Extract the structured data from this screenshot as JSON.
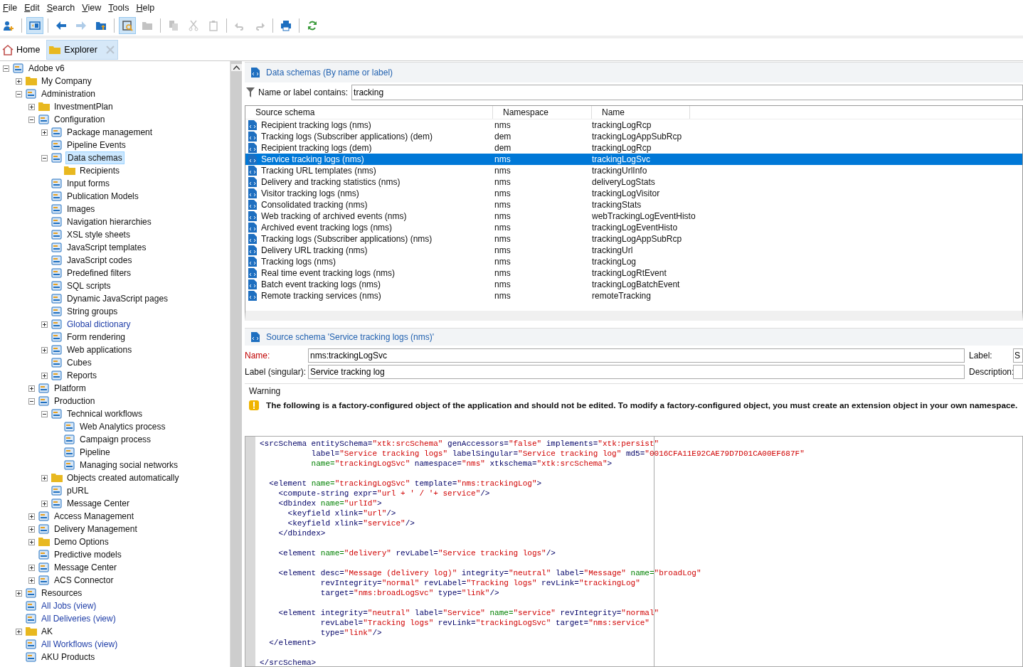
{
  "menu": [
    {
      "label": "File"
    },
    {
      "label": "Edit"
    },
    {
      "label": "Search"
    },
    {
      "label": "View"
    },
    {
      "label": "Tools"
    },
    {
      "label": "Help"
    }
  ],
  "toolbar": [
    {
      "pressed": false,
      "disabled": false
    },
    {
      "pressed": true,
      "disabled": false
    },
    {
      "pressed": false,
      "disabled": false
    },
    {
      "pressed": false,
      "disabled": true
    },
    {
      "pressed": false,
      "disabled": false
    },
    {
      "pressed": true,
      "disabled": false
    },
    {
      "pressed": false,
      "disabled": true
    },
    {
      "pressed": false,
      "disabled": true
    },
    {
      "pressed": false,
      "disabled": true
    },
    {
      "pressed": false,
      "disabled": true
    },
    {
      "pressed": false,
      "disabled": true
    },
    {
      "pressed": false,
      "disabled": true
    },
    {
      "pressed": false,
      "disabled": false
    },
    {
      "pressed": false,
      "disabled": false
    }
  ],
  "tabs": [
    {
      "label": "Home",
      "selected": false
    },
    {
      "label": "Explorer",
      "selected": true
    }
  ],
  "tree": [
    {
      "label": "Adobe v6",
      "kind": "item",
      "view": false,
      "selected": false,
      "expanded": true,
      "children": [
        {
          "label": "My Company",
          "kind": "folder",
          "view": false,
          "selected": false,
          "expanded": false
        },
        {
          "label": "Administration",
          "kind": "item",
          "view": false,
          "selected": false,
          "expanded": true,
          "children": [
            {
              "label": "InvestmentPlan",
              "kind": "folder",
              "view": false,
              "selected": false,
              "expanded": false
            },
            {
              "label": "Configuration",
              "kind": "item",
              "view": false,
              "selected": false,
              "expanded": true,
              "children": [
                {
                  "label": "Package management",
                  "kind": "item",
                  "view": false,
                  "selected": false,
                  "expanded": false
                },
                {
                  "label": "Pipeline Events",
                  "kind": "item",
                  "view": false,
                  "selected": false
                },
                {
                  "label": "Data schemas",
                  "kind": "item",
                  "view": false,
                  "selected": true,
                  "expanded": true,
                  "children": [
                    {
                      "label": "Recipients",
                      "kind": "folder",
                      "view": false,
                      "selected": false
                    }
                  ]
                },
                {
                  "label": "Input forms",
                  "kind": "item",
                  "view": false,
                  "selected": false
                },
                {
                  "label": "Publication Models",
                  "kind": "item",
                  "view": false,
                  "selected": false
                },
                {
                  "label": "Images",
                  "kind": "item",
                  "view": false,
                  "selected": false
                },
                {
                  "label": "Navigation hierarchies",
                  "kind": "item",
                  "view": false,
                  "selected": false
                },
                {
                  "label": "XSL style sheets",
                  "kind": "item",
                  "view": false,
                  "selected": false
                },
                {
                  "label": "JavaScript templates",
                  "kind": "item",
                  "view": false,
                  "selected": false
                },
                {
                  "label": "JavaScript codes",
                  "kind": "item",
                  "view": false,
                  "selected": false
                },
                {
                  "label": "Predefined filters",
                  "kind": "item",
                  "view": false,
                  "selected": false
                },
                {
                  "label": "SQL scripts",
                  "kind": "item",
                  "view": false,
                  "selected": false
                },
                {
                  "label": "Dynamic JavaScript pages",
                  "kind": "item",
                  "view": false,
                  "selected": false
                },
                {
                  "label": "String groups",
                  "kind": "item",
                  "view": false,
                  "selected": false
                },
                {
                  "label": "Global dictionary",
                  "kind": "item",
                  "view": true,
                  "selected": false,
                  "expanded": false
                },
                {
                  "label": "Form rendering",
                  "kind": "item",
                  "view": false,
                  "selected": false
                },
                {
                  "label": "Web applications",
                  "kind": "item",
                  "view": false,
                  "selected": false,
                  "expanded": false
                },
                {
                  "label": "Cubes",
                  "kind": "item",
                  "view": false,
                  "selected": false
                },
                {
                  "label": "Reports",
                  "kind": "item",
                  "view": false,
                  "selected": false,
                  "expanded": false
                }
              ]
            },
            {
              "label": "Platform",
              "kind": "item",
              "view": false,
              "selected": false,
              "expanded": false
            },
            {
              "label": "Production",
              "kind": "item",
              "view": false,
              "selected": false,
              "expanded": true,
              "children": [
                {
                  "label": "Technical workflows",
                  "kind": "item",
                  "view": false,
                  "selected": false,
                  "expanded": true,
                  "children": [
                    {
                      "label": "Web Analytics process",
                      "kind": "item",
                      "view": false,
                      "selected": false
                    },
                    {
                      "label": "Campaign process",
                      "kind": "item",
                      "view": false,
                      "selected": false
                    },
                    {
                      "label": "Pipeline",
                      "kind": "item",
                      "view": false,
                      "selected": false
                    },
                    {
                      "label": "Managing social networks",
                      "kind": "item",
                      "view": false,
                      "selected": false
                    }
                  ]
                },
                {
                  "label": "Objects created automatically",
                  "kind": "folder",
                  "view": false,
                  "selected": false,
                  "expanded": false
                },
                {
                  "label": "pURL",
                  "kind": "item",
                  "view": false,
                  "selected": false
                },
                {
                  "label": "Message Center",
                  "kind": "item",
                  "view": false,
                  "selected": false,
                  "expanded": false
                }
              ]
            },
            {
              "label": "Access Management",
              "kind": "item",
              "view": false,
              "selected": false,
              "expanded": false
            },
            {
              "label": "Delivery Management",
              "kind": "item",
              "view": false,
              "selected": false,
              "expanded": false
            },
            {
              "label": "Demo Options",
              "kind": "folder",
              "view": false,
              "selected": false,
              "expanded": false
            },
            {
              "label": "Predictive models",
              "kind": "item",
              "view": false,
              "selected": false
            },
            {
              "label": "Message Center",
              "kind": "item",
              "view": false,
              "selected": false,
              "expanded": false
            },
            {
              "label": "ACS Connector",
              "kind": "item",
              "view": false,
              "selected": false,
              "expanded": false
            }
          ]
        },
        {
          "label": "Resources",
          "kind": "item",
          "view": false,
          "selected": false,
          "expanded": false
        },
        {
          "label": "All Jobs (view)",
          "kind": "item",
          "view": true,
          "selected": false
        },
        {
          "label": "All Deliveries (view)",
          "kind": "item",
          "view": true,
          "selected": false
        },
        {
          "label": "AK",
          "kind": "folder",
          "view": false,
          "selected": false,
          "expanded": false
        },
        {
          "label": "All Workflows (view)",
          "kind": "item",
          "view": true,
          "selected": false
        },
        {
          "label": "AKU Products",
          "kind": "item",
          "view": false,
          "selected": false
        }
      ]
    }
  ],
  "list_panel": {
    "title": "Data schemas (By name or label)",
    "filter_label": "Name or label contains:",
    "filter_value": "tracking",
    "columns": [
      "Source schema",
      "Namespace",
      "Name"
    ],
    "rows": [
      {
        "source_schema": "Recipient tracking logs (nms)",
        "namespace": "nms",
        "name": "trackingLogRcp",
        "selected": false
      },
      {
        "source_schema": "Tracking logs (Subscriber applications) (dem)",
        "namespace": "dem",
        "name": "trackingLogAppSubRcp",
        "selected": false
      },
      {
        "source_schema": "Recipient tracking logs (dem)",
        "namespace": "dem",
        "name": "trackingLogRcp",
        "selected": false
      },
      {
        "source_schema": "Service tracking logs (nms)",
        "namespace": "nms",
        "name": "trackingLogSvc",
        "selected": true
      },
      {
        "source_schema": "Tracking URL templates (nms)",
        "namespace": "nms",
        "name": "trackingUrlInfo",
        "selected": false
      },
      {
        "source_schema": "Delivery and tracking statistics (nms)",
        "namespace": "nms",
        "name": "deliveryLogStats",
        "selected": false
      },
      {
        "source_schema": "Visitor tracking logs (nms)",
        "namespace": "nms",
        "name": "trackingLogVisitor",
        "selected": false
      },
      {
        "source_schema": "Consolidated tracking (nms)",
        "namespace": "nms",
        "name": "trackingStats",
        "selected": false
      },
      {
        "source_schema": "Web tracking of archived events (nms)",
        "namespace": "nms",
        "name": "webTrackingLogEventHisto",
        "selected": false
      },
      {
        "source_schema": "Archived event tracking logs (nms)",
        "namespace": "nms",
        "name": "trackingLogEventHisto",
        "selected": false
      },
      {
        "source_schema": "Tracking logs (Subscriber applications) (nms)",
        "namespace": "nms",
        "name": "trackingLogAppSubRcp",
        "selected": false
      },
      {
        "source_schema": "Delivery URL tracking (nms)",
        "namespace": "nms",
        "name": "trackingUrl",
        "selected": false
      },
      {
        "source_schema": "Tracking logs (nms)",
        "namespace": "nms",
        "name": "trackingLog",
        "selected": false
      },
      {
        "source_schema": "Real time event tracking logs (nms)",
        "namespace": "nms",
        "name": "trackingLogRtEvent",
        "selected": false
      },
      {
        "source_schema": "Batch event tracking logs (nms)",
        "namespace": "nms",
        "name": "trackingLogBatchEvent",
        "selected": false
      },
      {
        "source_schema": "Remote tracking services (nms)",
        "namespace": "nms",
        "name": "remoteTracking",
        "selected": false
      }
    ]
  },
  "detail_panel": {
    "title": "Source schema 'Service tracking logs (nms)'",
    "name_label": "Name:",
    "name_value": "nms:trackingLogSvc",
    "label_label": "Label:",
    "label_value": "S",
    "singular_label": "Label (singular):",
    "singular_value": "Service tracking log",
    "description_label": "Description:",
    "warning_title": "Warning",
    "warning_text": "The following is a factory-configured object of the application and should not be edited. To modify a factory-configured object, you must create an extension object in your own namespace."
  },
  "code": [
    {
      "blank_before": false,
      "tokens": [
        {
          "kind": "plain",
          "text": "<srcSchema entitySchema="
        },
        {
          "kind": "value",
          "text": "\"xtk:srcSchema\""
        },
        {
          "kind": "plain",
          "text": " genAccessors="
        },
        {
          "kind": "value",
          "text": "\"false\""
        },
        {
          "kind": "plain",
          "text": " implements="
        },
        {
          "kind": "value",
          "text": "\"xtk:persist\""
        }
      ]
    },
    {
      "blank_before": false,
      "tokens": [
        {
          "kind": "plain",
          "text": "           label="
        },
        {
          "kind": "value",
          "text": "\"Service tracking logs\""
        },
        {
          "kind": "plain",
          "text": " labelSingular="
        },
        {
          "kind": "value",
          "text": "\"Service tracking log\""
        },
        {
          "kind": "plain",
          "text": " md5="
        },
        {
          "kind": "value",
          "text": "\"0016CFA11E92CAE79D7D01CA00EF687F\""
        }
      ]
    },
    {
      "blank_before": false,
      "tokens": [
        {
          "kind": "key",
          "text": "           name="
        },
        {
          "kind": "value",
          "text": "\"trackingLogSvc\""
        },
        {
          "kind": "plain",
          "text": " namespace="
        },
        {
          "kind": "value",
          "text": "\"nms\""
        },
        {
          "kind": "plain",
          "text": " xtkschema="
        },
        {
          "kind": "value",
          "text": "\"xtk:srcSchema\""
        },
        {
          "kind": "plain",
          "text": ">"
        }
      ]
    },
    {
      "blank_before": true,
      "tokens": [
        {
          "kind": "plain",
          "text": "  <element "
        },
        {
          "kind": "key",
          "text": "name="
        },
        {
          "kind": "value",
          "text": "\"trackingLogSvc\""
        },
        {
          "kind": "plain",
          "text": " template="
        },
        {
          "kind": "value",
          "text": "\"nms:trackingLog\""
        },
        {
          "kind": "plain",
          "text": ">"
        }
      ]
    },
    {
      "blank_before": false,
      "tokens": [
        {
          "kind": "plain",
          "text": "    <compute-string expr="
        },
        {
          "kind": "value",
          "text": "\"url + ' / '+ service\""
        },
        {
          "kind": "plain",
          "text": "/>"
        }
      ]
    },
    {
      "blank_before": false,
      "tokens": [
        {
          "kind": "plain",
          "text": "    <dbindex "
        },
        {
          "kind": "key",
          "text": "name="
        },
        {
          "kind": "value",
          "text": "\"urlId\""
        },
        {
          "kind": "plain",
          "text": ">"
        }
      ]
    },
    {
      "blank_before": false,
      "tokens": [
        {
          "kind": "plain",
          "text": "      <keyfield xlink="
        },
        {
          "kind": "value",
          "text": "\"url\""
        },
        {
          "kind": "plain",
          "text": "/>"
        }
      ]
    },
    {
      "blank_before": false,
      "tokens": [
        {
          "kind": "plain",
          "text": "      <keyfield xlink="
        },
        {
          "kind": "value",
          "text": "\"service\""
        },
        {
          "kind": "plain",
          "text": "/>"
        }
      ]
    },
    {
      "blank_before": false,
      "tokens": [
        {
          "kind": "plain",
          "text": "    </dbindex>"
        }
      ]
    },
    {
      "blank_before": true,
      "tokens": [
        {
          "kind": "plain",
          "text": "    <element "
        },
        {
          "kind": "key",
          "text": "name="
        },
        {
          "kind": "value",
          "text": "\"delivery\""
        },
        {
          "kind": "plain",
          "text": " revLabel="
        },
        {
          "kind": "value",
          "text": "\"Service tracking logs\""
        },
        {
          "kind": "plain",
          "text": "/>"
        }
      ]
    },
    {
      "blank_before": true,
      "tokens": [
        {
          "kind": "plain",
          "text": "    <element desc="
        },
        {
          "kind": "value",
          "text": "\"Message (delivery log)\""
        },
        {
          "kind": "plain",
          "text": " integrity="
        },
        {
          "kind": "value",
          "text": "\"neutral\""
        },
        {
          "kind": "plain",
          "text": " label="
        },
        {
          "kind": "value",
          "text": "\"Message\""
        },
        {
          "kind": "key",
          "text": " name="
        },
        {
          "kind": "value",
          "text": "\"broadLog\""
        }
      ]
    },
    {
      "blank_before": false,
      "tokens": [
        {
          "kind": "plain",
          "text": "             revIntegrity="
        },
        {
          "kind": "value",
          "text": "\"normal\""
        },
        {
          "kind": "plain",
          "text": " revLabel="
        },
        {
          "kind": "value",
          "text": "\"Tracking logs\""
        },
        {
          "kind": "plain",
          "text": " revLink="
        },
        {
          "kind": "value",
          "text": "\"trackingLog\""
        }
      ]
    },
    {
      "blank_before": false,
      "tokens": [
        {
          "kind": "plain",
          "text": "             target="
        },
        {
          "kind": "value",
          "text": "\"nms:broadLogSvc\""
        },
        {
          "kind": "plain",
          "text": " type="
        },
        {
          "kind": "value",
          "text": "\"link\""
        },
        {
          "kind": "plain",
          "text": "/>"
        }
      ]
    },
    {
      "blank_before": true,
      "tokens": [
        {
          "kind": "plain",
          "text": "    <element integrity="
        },
        {
          "kind": "value",
          "text": "\"neutral\""
        },
        {
          "kind": "plain",
          "text": " label="
        },
        {
          "kind": "value",
          "text": "\"Service\""
        },
        {
          "kind": "key",
          "text": " name="
        },
        {
          "kind": "value",
          "text": "\"service\""
        },
        {
          "kind": "plain",
          "text": " revIntegrity="
        },
        {
          "kind": "value",
          "text": "\"normal\""
        }
      ]
    },
    {
      "blank_before": false,
      "tokens": [
        {
          "kind": "plain",
          "text": "             revLabel="
        },
        {
          "kind": "value",
          "text": "\"Tracking logs\""
        },
        {
          "kind": "plain",
          "text": " revLink="
        },
        {
          "kind": "value",
          "text": "\"trackingLogSvc\""
        },
        {
          "kind": "plain",
          "text": " target="
        },
        {
          "kind": "value",
          "text": "\"nms:service\""
        }
      ]
    },
    {
      "blank_before": false,
      "tokens": [
        {
          "kind": "plain",
          "text": "             type="
        },
        {
          "kind": "value",
          "text": "\"link\""
        },
        {
          "kind": "plain",
          "text": "/>"
        }
      ]
    },
    {
      "blank_before": false,
      "tokens": [
        {
          "kind": "plain",
          "text": "  </element>"
        }
      ]
    },
    {
      "blank_before": true,
      "tokens": [
        {
          "kind": "plain",
          "text": "</srcSchema>"
        }
      ]
    }
  ]
}
